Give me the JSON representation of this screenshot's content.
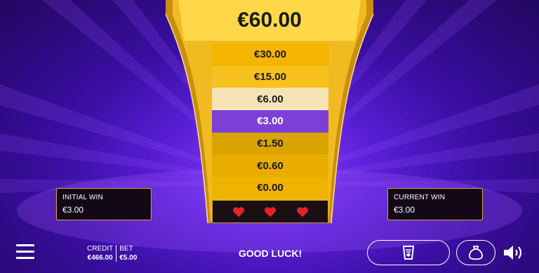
{
  "prize_ladder": {
    "top_prize": "€60.00",
    "rungs": [
      "€30.00",
      "€15.00",
      "€6.00",
      "€3.00",
      "€1.50",
      "€0.60",
      "€0.00"
    ]
  },
  "lives": {
    "remaining": 3,
    "icon": "heart-icon"
  },
  "initial_win": {
    "label": "INITIAL WIN",
    "value": "€3.00"
  },
  "current_win": {
    "label": "CURRENT WIN",
    "value": "€3.00"
  },
  "footer": {
    "credit_label": "CREDIT",
    "credit_value": "€466.00",
    "bet_label": "BET",
    "bet_value": "€5.00",
    "status_message": "GOOD LUCK!"
  },
  "icons": {
    "menu": "menu-icon",
    "collect": "collect-icon",
    "money_bag": "money-bag-icon",
    "sound": "sound-icon"
  },
  "colors": {
    "gold": "#f4b400",
    "current_rung": "#7e3fd8",
    "passed_rung": "#f5e3b6",
    "heart": "#e8202a"
  }
}
